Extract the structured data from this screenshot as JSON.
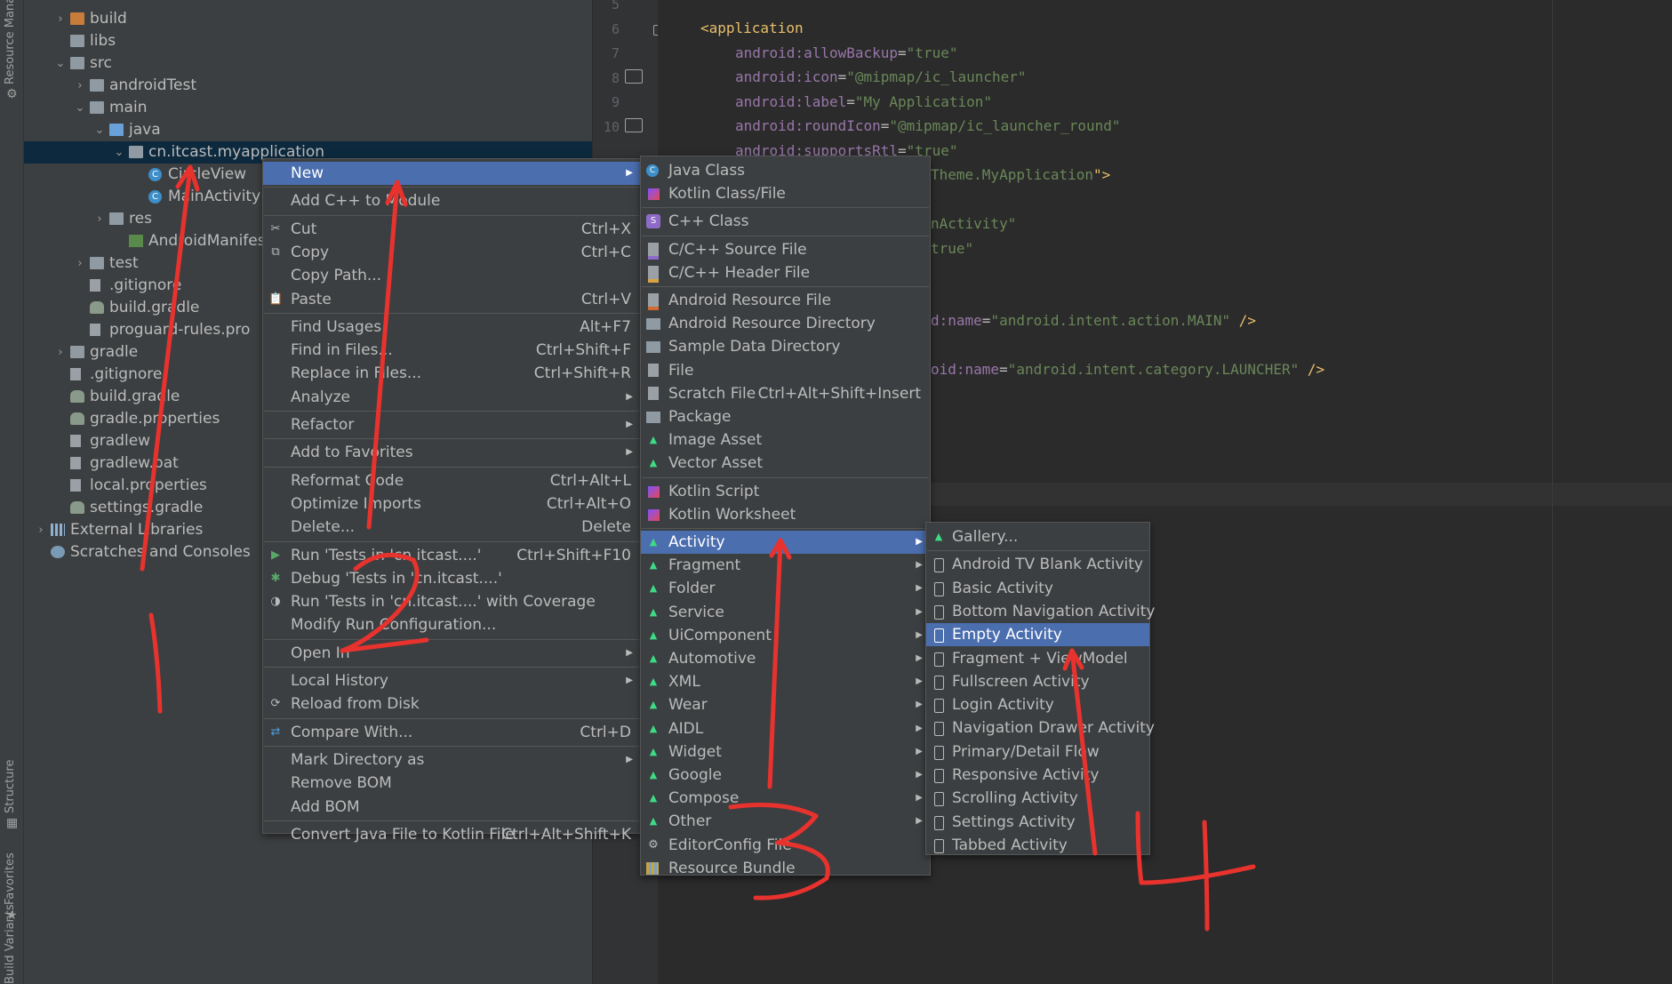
{
  "toolstrip": {
    "resource_manager": "Resource Manager",
    "structure": "Structure",
    "favorites": "Favorites",
    "variants": "Build Variants"
  },
  "project_tree": [
    {
      "label": "build",
      "indent": 1,
      "arrow": "›",
      "icon": "folder-orange"
    },
    {
      "label": "libs",
      "indent": 1,
      "arrow": "",
      "icon": "folder"
    },
    {
      "label": "src",
      "indent": 1,
      "arrow": "⌄",
      "icon": "folder"
    },
    {
      "label": "androidTest",
      "indent": 2,
      "arrow": "›",
      "icon": "folder"
    },
    {
      "label": "main",
      "indent": 2,
      "arrow": "⌄",
      "icon": "folder"
    },
    {
      "label": "java",
      "indent": 3,
      "arrow": "⌄",
      "icon": "folder-blue"
    },
    {
      "label": "cn.itcast.myapplication",
      "indent": 4,
      "arrow": "⌄",
      "icon": "package",
      "selected": true
    },
    {
      "label": "CircleView",
      "indent": 5,
      "arrow": "",
      "icon": "class"
    },
    {
      "label": "MainActivity",
      "indent": 5,
      "arrow": "",
      "icon": "class"
    },
    {
      "label": "res",
      "indent": 3,
      "arrow": "›",
      "icon": "folder"
    },
    {
      "label": "AndroidManifest.xml",
      "indent": 4,
      "arrow": "",
      "icon": "manifest"
    },
    {
      "label": "test",
      "indent": 2,
      "arrow": "›",
      "icon": "folder"
    },
    {
      "label": ".gitignore",
      "indent": 2,
      "arrow": "",
      "icon": "file"
    },
    {
      "label": "build.gradle",
      "indent": 2,
      "arrow": "",
      "icon": "gradle"
    },
    {
      "label": "proguard-rules.pro",
      "indent": 2,
      "arrow": "",
      "icon": "file"
    },
    {
      "label": "gradle",
      "indent": 1,
      "arrow": "›",
      "icon": "folder"
    },
    {
      "label": ".gitignore",
      "indent": 1,
      "arrow": "",
      "icon": "file"
    },
    {
      "label": "build.gradle",
      "indent": 1,
      "arrow": "",
      "icon": "gradle"
    },
    {
      "label": "gradle.properties",
      "indent": 1,
      "arrow": "",
      "icon": "gradle"
    },
    {
      "label": "gradlew",
      "indent": 1,
      "arrow": "",
      "icon": "file"
    },
    {
      "label": "gradlew.bat",
      "indent": 1,
      "arrow": "",
      "icon": "file"
    },
    {
      "label": "local.properties",
      "indent": 1,
      "arrow": "",
      "icon": "file"
    },
    {
      "label": "settings.gradle",
      "indent": 1,
      "arrow": "",
      "icon": "gradle"
    },
    {
      "label": "External Libraries",
      "indent": 0,
      "arrow": "›",
      "icon": "libs"
    },
    {
      "label": "Scratches and Consoles",
      "indent": 0,
      "arrow": "",
      "icon": "scratch"
    }
  ],
  "gutter": {
    "line_numbers": [
      "5",
      "6",
      "7",
      "8",
      "9",
      "10"
    ]
  },
  "editor": {
    "lines": [
      {
        "t": "<application"
      },
      {
        "a": "android:allowBackup",
        "v": "\"true\""
      },
      {
        "a": "android:icon",
        "v": "\"@mipmap/ic_launcher\""
      },
      {
        "a": "android:label",
        "v": "\"My Application\""
      },
      {
        "a": "android:roundIcon",
        "v": "\"@mipmap/ic_launcher_round\""
      },
      {
        "a": "android:supportsRtl",
        "v": "\"true\""
      }
    ],
    "fragments": [
      "Theme.MyApplication\">",
      "nActivity\"",
      "true\"",
      "d:name=\"android.intent.action.MAIN\" />",
      "oid:name=\"android.intent.category.LAUNCHER\" />"
    ]
  },
  "context_menu": [
    {
      "label": "New",
      "sub": true,
      "selected": true
    },
    {
      "sep": true
    },
    {
      "label": "Add C++ to Module"
    },
    {
      "sep": true
    },
    {
      "label": "Cut",
      "shortcut": "Ctrl+X",
      "icon": "✂"
    },
    {
      "label": "Copy",
      "shortcut": "Ctrl+C",
      "icon": "⧉"
    },
    {
      "label": "Copy Path..."
    },
    {
      "label": "Paste",
      "shortcut": "Ctrl+V",
      "icon": "📋"
    },
    {
      "sep": true
    },
    {
      "label": "Find Usages",
      "shortcut": "Alt+F7"
    },
    {
      "label": "Find in Files...",
      "shortcut": "Ctrl+Shift+F"
    },
    {
      "label": "Replace in Files...",
      "shortcut": "Ctrl+Shift+R"
    },
    {
      "label": "Analyze",
      "sub": true
    },
    {
      "sep": true
    },
    {
      "label": "Refactor",
      "sub": true
    },
    {
      "sep": true
    },
    {
      "label": "Add to Favorites",
      "sub": true
    },
    {
      "sep": true
    },
    {
      "label": "Reformat Code",
      "shortcut": "Ctrl+Alt+L"
    },
    {
      "label": "Optimize Imports",
      "shortcut": "Ctrl+Alt+O"
    },
    {
      "label": "Delete...",
      "shortcut": "Delete"
    },
    {
      "sep": true
    },
    {
      "label": "Run 'Tests in 'cn.itcast....'",
      "shortcut": "Ctrl+Shift+F10",
      "icon": "▶",
      "iconColor": "#59a869"
    },
    {
      "label": "Debug 'Tests in 'cn.itcast....'",
      "icon": "✱",
      "iconColor": "#59a869"
    },
    {
      "label": "Run 'Tests in 'cn.itcast....' with Coverage",
      "icon": "◑",
      "iconColor": "#bbbbbb"
    },
    {
      "label": "Modify Run Configuration..."
    },
    {
      "sep": true
    },
    {
      "label": "Open In",
      "sub": true
    },
    {
      "sep": true
    },
    {
      "label": "Local History",
      "sub": true
    },
    {
      "label": "Reload from Disk",
      "icon": "⟳"
    },
    {
      "sep": true
    },
    {
      "label": "Compare With...",
      "shortcut": "Ctrl+D",
      "icon": "⇄",
      "iconColor": "#4a9ad8"
    },
    {
      "sep": true
    },
    {
      "label": "Mark Directory as",
      "sub": true
    },
    {
      "label": "Remove BOM"
    },
    {
      "label": "Add BOM"
    },
    {
      "sep": true
    },
    {
      "label": "Convert Java File to Kotlin File",
      "shortcut": "Ctrl+Alt+Shift+K"
    }
  ],
  "new_menu": [
    {
      "label": "Java Class",
      "icon": "C",
      "kind": "jclass"
    },
    {
      "label": "Kotlin Class/File",
      "icon": "K",
      "kind": "kotlin"
    },
    {
      "sep": true
    },
    {
      "label": "C++ Class",
      "icon": "S",
      "kind": "cpp"
    },
    {
      "sep": true
    },
    {
      "label": "C/C++ Source File",
      "icon": "c",
      "kind": "cfile"
    },
    {
      "label": "C/C++ Header File",
      "icon": "h",
      "kind": "hfile"
    },
    {
      "sep": true
    },
    {
      "label": "Android Resource File",
      "icon": "r",
      "kind": "resfile"
    },
    {
      "label": "Android Resource Directory",
      "kind": "folder"
    },
    {
      "label": "Sample Data Directory",
      "kind": "folder"
    },
    {
      "label": "File",
      "kind": "file"
    },
    {
      "label": "Scratch File",
      "shortcut": "Ctrl+Alt+Shift+Insert",
      "kind": "file"
    },
    {
      "label": "Package",
      "kind": "folder"
    },
    {
      "label": "Image Asset",
      "kind": "android"
    },
    {
      "label": "Vector Asset",
      "kind": "android"
    },
    {
      "sep": true
    },
    {
      "label": "Kotlin Script",
      "kind": "kotlin"
    },
    {
      "label": "Kotlin Worksheet",
      "kind": "kotlin"
    },
    {
      "sep": true
    },
    {
      "label": "Activity",
      "sub": true,
      "selected": true,
      "kind": "android"
    },
    {
      "label": "Fragment",
      "sub": true,
      "kind": "android"
    },
    {
      "label": "Folder",
      "sub": true,
      "kind": "android"
    },
    {
      "label": "Service",
      "sub": true,
      "kind": "android"
    },
    {
      "label": "UiComponent",
      "sub": true,
      "kind": "android"
    },
    {
      "label": "Automotive",
      "sub": true,
      "kind": "android"
    },
    {
      "label": "XML",
      "sub": true,
      "kind": "android"
    },
    {
      "label": "Wear",
      "sub": true,
      "kind": "android"
    },
    {
      "label": "AIDL",
      "sub": true,
      "kind": "android"
    },
    {
      "label": "Widget",
      "sub": true,
      "kind": "android"
    },
    {
      "label": "Google",
      "sub": true,
      "kind": "android"
    },
    {
      "label": "Compose",
      "sub": true,
      "kind": "android"
    },
    {
      "label": "Other",
      "sub": true,
      "kind": "android"
    },
    {
      "label": "EditorConfig File",
      "kind": "gear"
    },
    {
      "label": "Resource Bundle",
      "kind": "bundle"
    }
  ],
  "activity_menu": [
    {
      "label": "Gallery...",
      "kind": "android"
    },
    {
      "sep": true
    },
    {
      "label": "Android TV Blank Activity",
      "kind": "phone"
    },
    {
      "label": "Basic Activity",
      "kind": "phone"
    },
    {
      "label": "Bottom Navigation Activity",
      "kind": "phone"
    },
    {
      "label": "Empty Activity",
      "kind": "phone",
      "selected": true
    },
    {
      "label": "Fragment + ViewModel",
      "kind": "phone"
    },
    {
      "label": "Fullscreen Activity",
      "kind": "phone"
    },
    {
      "label": "Login Activity",
      "kind": "phone"
    },
    {
      "label": "Navigation Drawer Activity",
      "kind": "phone"
    },
    {
      "label": "Primary/Detail Flow",
      "kind": "phone"
    },
    {
      "label": "Responsive Activity",
      "kind": "phone"
    },
    {
      "label": "Scrolling Activity",
      "kind": "phone"
    },
    {
      "label": "Settings Activity",
      "kind": "phone"
    },
    {
      "label": "Tabbed Activity",
      "kind": "phone"
    }
  ],
  "colors": {
    "selection": "#4b6eaf",
    "tree_selection": "#0d293e",
    "annotation": "#e8322e"
  }
}
